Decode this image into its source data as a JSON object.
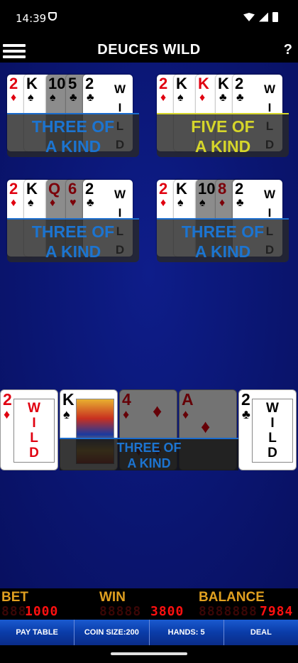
{
  "status": {
    "time": "14:39"
  },
  "header": {
    "title": "DEUCES WILD",
    "help": "?"
  },
  "mini_hands": [
    {
      "result": "THREE OF A KIND",
      "result_line1": "THREE OF",
      "result_line2": "A KIND",
      "color": "blue",
      "cards": [
        {
          "rank": "2",
          "suit": "♦"
        },
        {
          "rank": "K",
          "suit": "♠"
        },
        {
          "rank": "10",
          "suit": "♠"
        },
        {
          "rank": "5",
          "suit": "♣"
        },
        {
          "rank": "2",
          "suit": "♣"
        }
      ]
    },
    {
      "result": "FIVE OF A KIND",
      "result_line1": "FIVE OF",
      "result_line2": "A KIND",
      "color": "yellow",
      "cards": [
        {
          "rank": "2",
          "suit": "♦"
        },
        {
          "rank": "K",
          "suit": "♠"
        },
        {
          "rank": "K",
          "suit": "♦"
        },
        {
          "rank": "K",
          "suit": "♣"
        },
        {
          "rank": "2",
          "suit": "♣"
        }
      ]
    },
    {
      "result": "THREE OF A KIND",
      "result_line1": "THREE OF",
      "result_line2": "A KIND",
      "color": "blue",
      "cards": [
        {
          "rank": "2",
          "suit": "♦"
        },
        {
          "rank": "K",
          "suit": "♠"
        },
        {
          "rank": "Q",
          "suit": "♦"
        },
        {
          "rank": "6",
          "suit": "♥"
        },
        {
          "rank": "2",
          "suit": "♣"
        }
      ]
    },
    {
      "result": "THREE OF A KIND",
      "result_line1": "THREE OF",
      "result_line2": "A KIND",
      "color": "blue",
      "cards": [
        {
          "rank": "2",
          "suit": "♦"
        },
        {
          "rank": "K",
          "suit": "♠"
        },
        {
          "rank": "10",
          "suit": "♠"
        },
        {
          "rank": "8",
          "suit": "♦"
        },
        {
          "rank": "2",
          "suit": "♣"
        }
      ]
    }
  ],
  "wild_letters": [
    "W",
    "I",
    "L",
    "D"
  ],
  "main_hand": {
    "result_line1": "THREE OF",
    "result_line2": "A KIND",
    "cards": [
      {
        "rank": "2",
        "suit": "♦",
        "held": true
      },
      {
        "rank": "K",
        "suit": "♠",
        "held": true
      },
      {
        "rank": "4",
        "suit": "♦",
        "held": false
      },
      {
        "rank": "A",
        "suit": "♦",
        "held": false
      },
      {
        "rank": "2",
        "suit": "♣",
        "held": true
      }
    ]
  },
  "score": {
    "bet_label": "BET",
    "bet": "1000",
    "bet_ghost": "888",
    "win_label": "WIN",
    "win": "3800",
    "win_ghost": "88888",
    "balance_label": "BALANCE",
    "balance": "7984",
    "balance_ghost": "8888888"
  },
  "buttons": {
    "pay_table": "PAY TABLE",
    "coin_size": "COIN SIZE:200",
    "hands": "HANDS: 5",
    "deal": "DEAL"
  },
  "colors": {
    "table_bg": "#0a1570",
    "button_bar": "#0a3ca8",
    "score_label": "#e0a020",
    "led": "#ff1010",
    "banner_blue": "#1c74d0",
    "banner_yellow": "#d6d62a"
  }
}
